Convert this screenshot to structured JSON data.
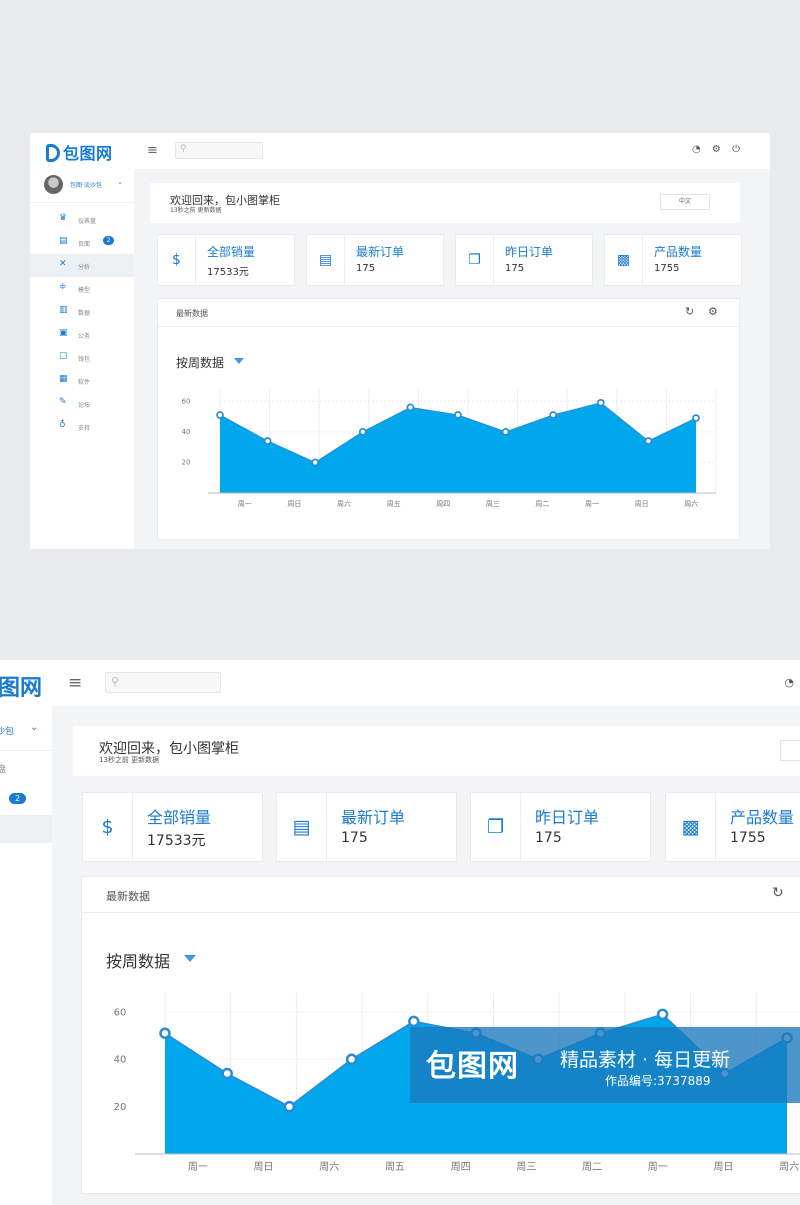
{
  "app": {
    "logo": "包图网",
    "logo_cropped": "图网"
  },
  "user": {
    "name": "包图·淡沙包",
    "name_cropped": "沙包"
  },
  "sidebar": {
    "items": [
      {
        "label": "仪表盘",
        "icon": "crown-icon"
      },
      {
        "label": "页面",
        "icon": "page-icon",
        "badge": "2"
      },
      {
        "label": "分析",
        "icon": "analysis-icon",
        "active": true
      },
      {
        "label": "模型",
        "icon": "sliders-icon"
      },
      {
        "label": "数据",
        "icon": "bar-chart-icon"
      },
      {
        "label": "公务",
        "icon": "briefcase-icon"
      },
      {
        "label": "钱包",
        "icon": "wallet-icon"
      },
      {
        "label": "软件",
        "icon": "calendar-icon"
      },
      {
        "label": "论坛",
        "icon": "edit-icon"
      },
      {
        "label": "支持",
        "icon": "location-icon"
      }
    ],
    "cropped_first_label": "盘"
  },
  "welcome": {
    "title": "欢迎回来，包小图掌柜",
    "subtitle": "13秒之前 更新数据",
    "language": "中文"
  },
  "stats": [
    {
      "title": "全部销量",
      "value": "17533元",
      "icon": "money-bag-icon"
    },
    {
      "title": "最新订单",
      "value": "175",
      "icon": "clipboard-icon"
    },
    {
      "title": "昨日订单",
      "value": "175",
      "icon": "windows-icon"
    },
    {
      "title": "产品数量",
      "value": "1755",
      "icon": "stack-icon"
    }
  ],
  "panel": {
    "title": "最新数据",
    "dropdown": "按周数据"
  },
  "colors": {
    "accent": "#1a7bd1",
    "area": "#00a7ec",
    "line": "#2a8ad4"
  },
  "chart_data": {
    "type": "area",
    "categories": [
      "周一",
      "周日",
      "周六",
      "周五",
      "周四",
      "周三",
      "周二",
      "周一",
      "周日",
      "周六"
    ],
    "values": [
      51,
      34,
      20,
      40,
      56,
      51,
      40,
      51,
      59,
      34,
      49
    ],
    "yticks": [
      20,
      40,
      60
    ],
    "ylim": [
      0,
      68
    ]
  },
  "watermark": {
    "logo": "包图网",
    "title": "精品素材 · 每日更新",
    "id": "作品编号:3737889"
  }
}
